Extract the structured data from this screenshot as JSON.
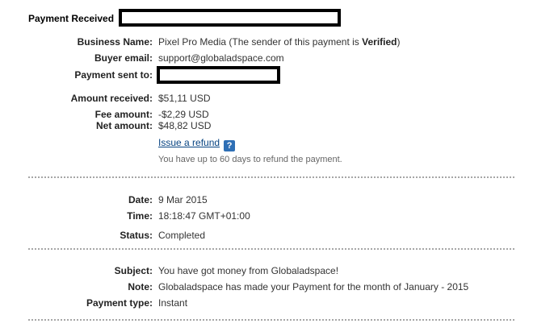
{
  "header": {
    "title": "Payment Received"
  },
  "details": {
    "business_name_label": "Business Name:",
    "business_name_value": "Pixel Pro Media",
    "verified_prefix": "(The sender of this payment is",
    "verified_word": "Verified",
    "verified_suffix": ")",
    "buyer_email_label": "Buyer email:",
    "buyer_email_value": "support@globaladspace.com",
    "payment_sent_to_label": "Payment sent to:"
  },
  "amounts": {
    "amount_received_label": "Amount received:",
    "amount_received_value": "$51,11 USD",
    "fee_amount_label": "Fee amount:",
    "fee_amount_value": "-$2,29 USD",
    "net_amount_label": "Net amount:",
    "net_amount_value": "$48,82 USD",
    "refund_link": "Issue a refund",
    "refund_help_icon": "?",
    "refund_note": "You have up to 60 days to refund the payment."
  },
  "transaction": {
    "date_label": "Date:",
    "date_value": "9 Mar 2015",
    "time_label": "Time:",
    "time_value": "18:18:47 GMT+01:00",
    "status_label": "Status:",
    "status_value": "Completed"
  },
  "message": {
    "subject_label": "Subject:",
    "subject_value": "You have got money from Globaladspace!",
    "note_label": "Note:",
    "note_value": "Globaladspace has made your Payment for the month of January - 2015",
    "payment_type_label": "Payment type:",
    "payment_type_value": "Instant"
  },
  "colors": {
    "link": "#084482",
    "help_icon_bg": "#2e6fb5",
    "divider": "#a6a6a6"
  }
}
